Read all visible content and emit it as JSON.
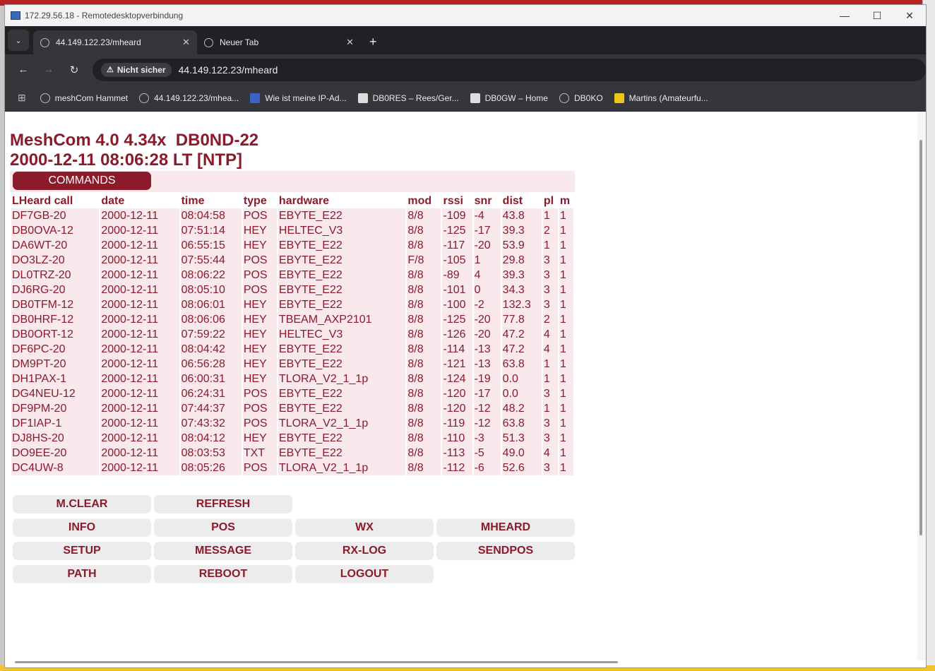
{
  "rdp": {
    "title": "172.29.56.18 - Remotedesktopverbindung",
    "minimize": "—",
    "maximize": "☐",
    "close": "✕"
  },
  "browser": {
    "tab_list_icon": "chevron-down-icon",
    "tabs": [
      {
        "label": "44.149.122.23/mheard",
        "close": "✕"
      },
      {
        "label": "Neuer Tab",
        "close": "✕"
      }
    ],
    "new_tab": "+",
    "nav": {
      "back": "←",
      "forward": "→",
      "reload": "↻"
    },
    "security_label": "Nicht sicher",
    "url": "44.149.122.23/mheard",
    "bookmarks": [
      {
        "label": "meshCom Hammet"
      },
      {
        "label": "44.149.122.23/mhea..."
      },
      {
        "label": "Wie ist meine IP-Ad..."
      },
      {
        "label": "DB0RES – Rees/Ger..."
      },
      {
        "label": "DB0GW – Home"
      },
      {
        "label": "DB0KO"
      },
      {
        "label": "Martins (Amateurfu..."
      }
    ]
  },
  "page": {
    "heading_line1": "MeshCom 4.0 4.34x  DB0ND-22",
    "heading_line2": "2000-12-11 08:06:28 LT [NTP]",
    "commands_label": "COMMANDS",
    "table": {
      "headers": [
        "LHeard call",
        "date",
        "time",
        "type",
        "hardware",
        "mod",
        "rssi",
        "snr",
        "dist",
        "pl",
        "m"
      ],
      "rows": [
        [
          "DF7GB-20",
          "2000-12-11",
          "08:04:58",
          "POS",
          "EBYTE_E22",
          "8/8",
          "-109",
          "-4",
          "43.8",
          "1",
          "1"
        ],
        [
          "DB0OVA-12",
          "2000-12-11",
          "07:51:14",
          "HEY",
          "HELTEC_V3",
          "8/8",
          "-125",
          "-17",
          "39.3",
          "2",
          "1"
        ],
        [
          "DA6WT-20",
          "2000-12-11",
          "06:55:15",
          "HEY",
          "EBYTE_E22",
          "8/8",
          "-117",
          "-20",
          "53.9",
          "1",
          "1"
        ],
        [
          "DO3LZ-20",
          "2000-12-11",
          "07:55:44",
          "POS",
          "EBYTE_E22",
          "F/8",
          "-105",
          "1",
          "29.8",
          "3",
          "1"
        ],
        [
          "DL0TRZ-20",
          "2000-12-11",
          "08:06:22",
          "POS",
          "EBYTE_E22",
          "8/8",
          "-89",
          "4",
          "39.3",
          "3",
          "1"
        ],
        [
          "DJ6RG-20",
          "2000-12-11",
          "08:05:10",
          "POS",
          "EBYTE_E22",
          "8/8",
          "-101",
          "0",
          "34.3",
          "3",
          "1"
        ],
        [
          "DB0TFM-12",
          "2000-12-11",
          "08:06:01",
          "HEY",
          "EBYTE_E22",
          "8/8",
          "-100",
          "-2",
          "132.3",
          "3",
          "1"
        ],
        [
          "DB0HRF-12",
          "2000-12-11",
          "08:06:06",
          "HEY",
          "TBEAM_AXP2101",
          "8/8",
          "-125",
          "-20",
          "77.8",
          "2",
          "1"
        ],
        [
          "DB0ORT-12",
          "2000-12-11",
          "07:59:22",
          "HEY",
          "HELTEC_V3",
          "8/8",
          "-126",
          "-20",
          "47.2",
          "4",
          "1"
        ],
        [
          "DF6PC-20",
          "2000-12-11",
          "08:04:42",
          "HEY",
          "EBYTE_E22",
          "8/8",
          "-114",
          "-13",
          "47.2",
          "4",
          "1"
        ],
        [
          "DM9PT-20",
          "2000-12-11",
          "06:56:28",
          "HEY",
          "EBYTE_E22",
          "8/8",
          "-121",
          "-13",
          "63.8",
          "1",
          "1"
        ],
        [
          "DH1PAX-1",
          "2000-12-11",
          "06:00:31",
          "HEY",
          "TLORA_V2_1_1p",
          "8/8",
          "-124",
          "-19",
          "0.0",
          "1",
          "1"
        ],
        [
          "DG4NEU-12",
          "2000-12-11",
          "06:24:31",
          "POS",
          "EBYTE_E22",
          "8/8",
          "-120",
          "-17",
          "0.0",
          "3",
          "1"
        ],
        [
          "DF9PM-20",
          "2000-12-11",
          "07:44:37",
          "POS",
          "EBYTE_E22",
          "8/8",
          "-120",
          "-12",
          "48.2",
          "1",
          "1"
        ],
        [
          "DF1IAP-1",
          "2000-12-11",
          "07:43:32",
          "POS",
          "TLORA_V2_1_1p",
          "8/8",
          "-119",
          "-12",
          "63.8",
          "3",
          "1"
        ],
        [
          "DJ8HS-20",
          "2000-12-11",
          "08:04:12",
          "HEY",
          "EBYTE_E22",
          "8/8",
          "-110",
          "-3",
          "51.3",
          "3",
          "1"
        ],
        [
          "DO9EE-20",
          "2000-12-11",
          "08:03:53",
          "TXT",
          "EBYTE_E22",
          "8/8",
          "-113",
          "-5",
          "49.0",
          "4",
          "1"
        ],
        [
          "DC4UW-8",
          "2000-12-11",
          "08:05:26",
          "POS",
          "TLORA_V2_1_1p",
          "8/8",
          "-112",
          "-6",
          "52.6",
          "3",
          "1"
        ]
      ]
    },
    "buttons": [
      {
        "label": "M.CLEAR",
        "name": "mclear-button"
      },
      {
        "label": "REFRESH",
        "name": "refresh-button"
      },
      {
        "label": "INFO",
        "name": "info-button"
      },
      {
        "label": "POS",
        "name": "pos-button"
      },
      {
        "label": "WX",
        "name": "wx-button"
      },
      {
        "label": "MHEARD",
        "name": "mheard-button"
      },
      {
        "label": "SETUP",
        "name": "setup-button"
      },
      {
        "label": "MESSAGE",
        "name": "message-button"
      },
      {
        "label": "RX-LOG",
        "name": "rxlog-button"
      },
      {
        "label": "SENDPOS",
        "name": "sendpos-button"
      },
      {
        "label": "PATH",
        "name": "path-button"
      },
      {
        "label": "REBOOT",
        "name": "reboot-button"
      },
      {
        "label": "LOGOUT",
        "name": "logout-button"
      }
    ]
  },
  "colors": {
    "brand": "#8b1a2b",
    "row_bg": "#f9e9ec",
    "button_bg": "#ececec"
  }
}
